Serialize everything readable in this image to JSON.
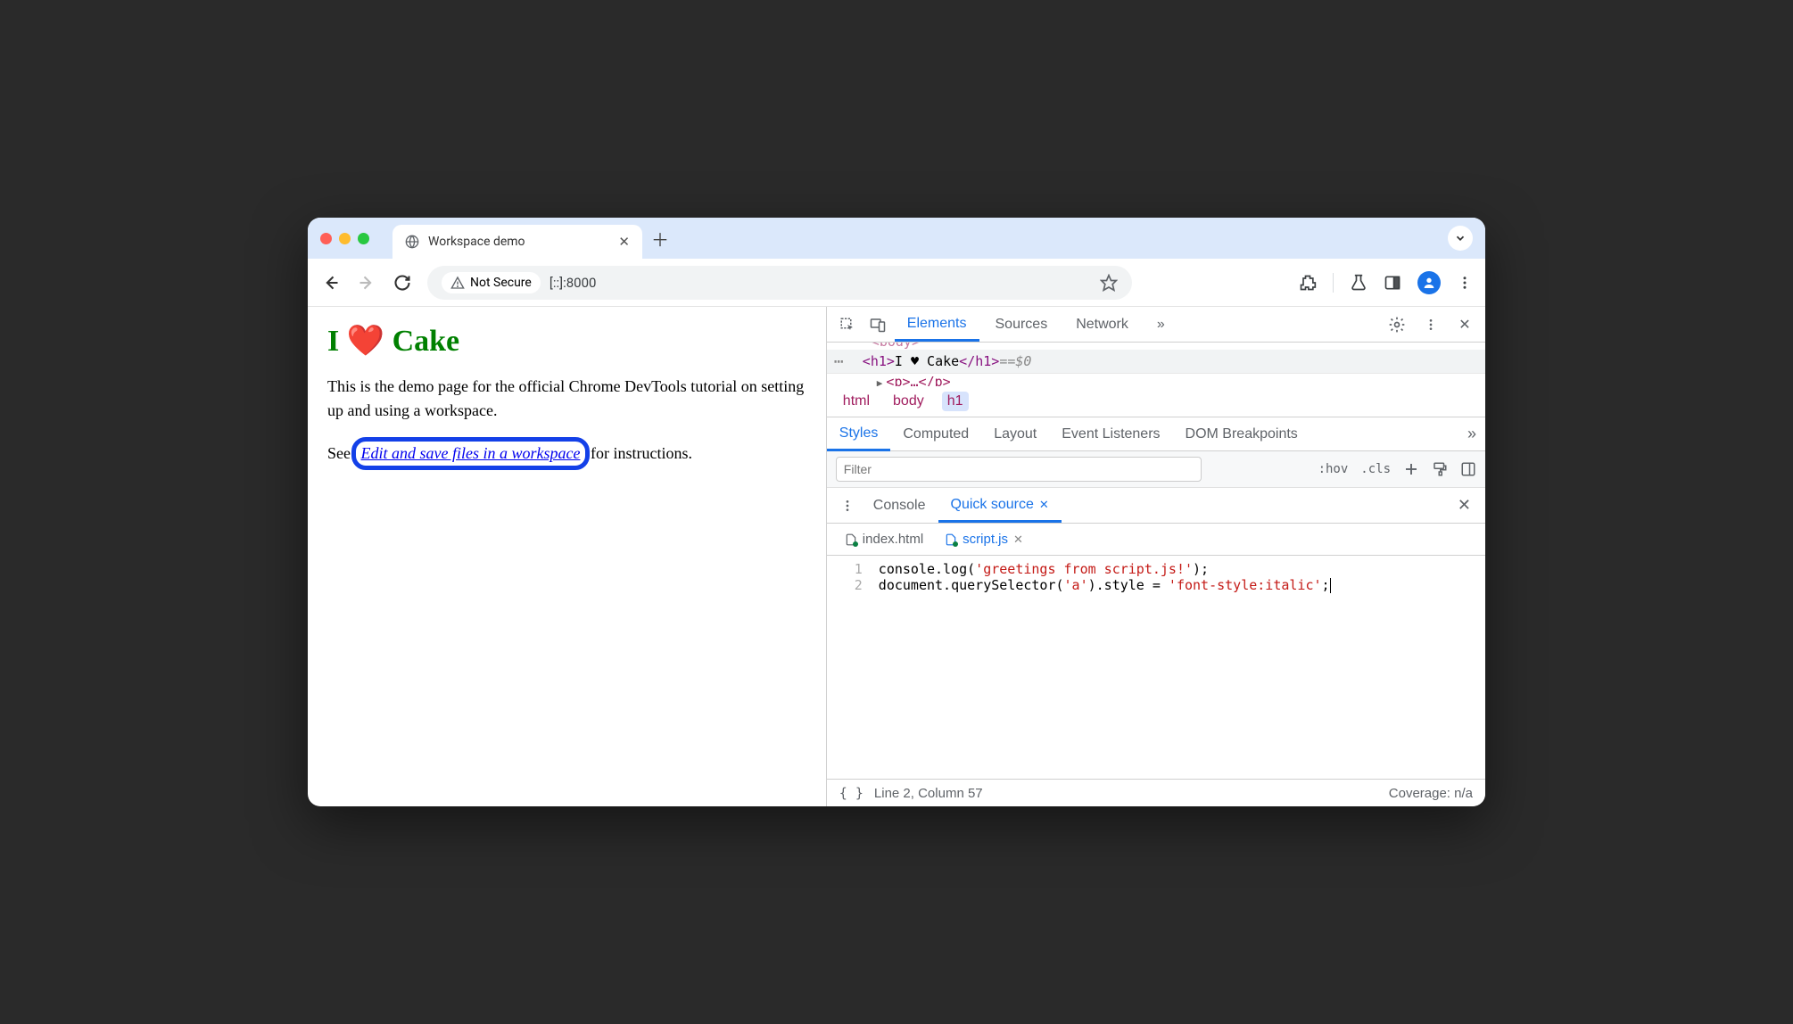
{
  "window": {
    "tab_title": "Workspace demo"
  },
  "toolbar": {
    "secure_label": "Not Secure",
    "url": "[::]:8000"
  },
  "page": {
    "h1_prefix": "I ",
    "h1_heart": "❤️",
    "h1_suffix": " Cake",
    "p1": "This is the demo page for the official Chrome DevTools tutorial on setting up and using a workspace.",
    "p2_prefix": "See ",
    "p2_link": "Edit and save files in a workspace",
    "p2_suffix": " for instructions."
  },
  "devtools": {
    "tabs": {
      "elements": "Elements",
      "sources": "Sources",
      "network": "Network"
    },
    "dom": {
      "above": "<body>",
      "open_tag": "<h1>",
      "text": "I ♥ Cake",
      "close_tag": "</h1>",
      "eq": " == ",
      "dollar": "$0",
      "below": "<p>…</p>"
    },
    "breadcrumb": {
      "html": "html",
      "body": "body",
      "h1": "h1"
    },
    "styles_tabs": {
      "styles": "Styles",
      "computed": "Computed",
      "layout": "Layout",
      "event": "Event Listeners",
      "dom_bp": "DOM Breakpoints"
    },
    "filter_placeholder": "Filter",
    "filter_controls": {
      "hov": ":hov",
      "cls": ".cls"
    },
    "drawer_tabs": {
      "console": "Console",
      "quick_source": "Quick source"
    },
    "file_tabs": {
      "index": "index.html",
      "script": "script.js"
    },
    "code": {
      "line1": "console.log('greetings from script.js!');",
      "line2": "document.querySelector('a').style = 'font-style:italic';",
      "line_numbers": [
        "1",
        "2"
      ]
    },
    "status": {
      "pos": "Line 2, Column 57",
      "coverage": "Coverage: n/a"
    }
  }
}
